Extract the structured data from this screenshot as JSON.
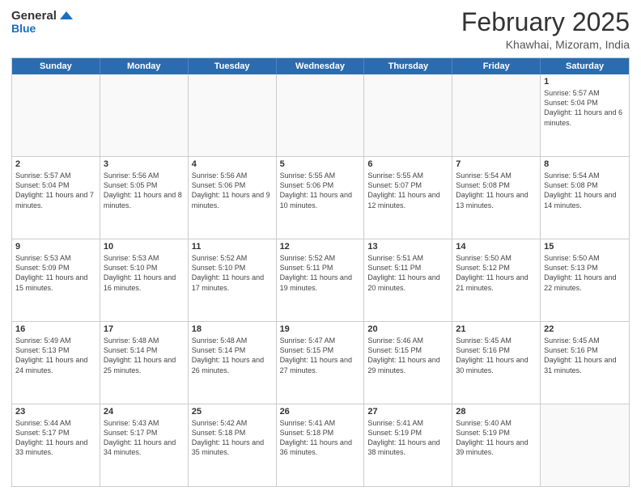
{
  "header": {
    "logo_line1": "General",
    "logo_line2": "Blue",
    "month": "February 2025",
    "location": "Khawhai, Mizoram, India"
  },
  "days_of_week": [
    "Sunday",
    "Monday",
    "Tuesday",
    "Wednesday",
    "Thursday",
    "Friday",
    "Saturday"
  ],
  "weeks": [
    [
      {
        "day": "",
        "info": ""
      },
      {
        "day": "",
        "info": ""
      },
      {
        "day": "",
        "info": ""
      },
      {
        "day": "",
        "info": ""
      },
      {
        "day": "",
        "info": ""
      },
      {
        "day": "",
        "info": ""
      },
      {
        "day": "1",
        "info": "Sunrise: 5:57 AM\nSunset: 5:04 PM\nDaylight: 11 hours and 6 minutes."
      }
    ],
    [
      {
        "day": "2",
        "info": "Sunrise: 5:57 AM\nSunset: 5:04 PM\nDaylight: 11 hours and 7 minutes."
      },
      {
        "day": "3",
        "info": "Sunrise: 5:56 AM\nSunset: 5:05 PM\nDaylight: 11 hours and 8 minutes."
      },
      {
        "day": "4",
        "info": "Sunrise: 5:56 AM\nSunset: 5:06 PM\nDaylight: 11 hours and 9 minutes."
      },
      {
        "day": "5",
        "info": "Sunrise: 5:55 AM\nSunset: 5:06 PM\nDaylight: 11 hours and 10 minutes."
      },
      {
        "day": "6",
        "info": "Sunrise: 5:55 AM\nSunset: 5:07 PM\nDaylight: 11 hours and 12 minutes."
      },
      {
        "day": "7",
        "info": "Sunrise: 5:54 AM\nSunset: 5:08 PM\nDaylight: 11 hours and 13 minutes."
      },
      {
        "day": "8",
        "info": "Sunrise: 5:54 AM\nSunset: 5:08 PM\nDaylight: 11 hours and 14 minutes."
      }
    ],
    [
      {
        "day": "9",
        "info": "Sunrise: 5:53 AM\nSunset: 5:09 PM\nDaylight: 11 hours and 15 minutes."
      },
      {
        "day": "10",
        "info": "Sunrise: 5:53 AM\nSunset: 5:10 PM\nDaylight: 11 hours and 16 minutes."
      },
      {
        "day": "11",
        "info": "Sunrise: 5:52 AM\nSunset: 5:10 PM\nDaylight: 11 hours and 17 minutes."
      },
      {
        "day": "12",
        "info": "Sunrise: 5:52 AM\nSunset: 5:11 PM\nDaylight: 11 hours and 19 minutes."
      },
      {
        "day": "13",
        "info": "Sunrise: 5:51 AM\nSunset: 5:11 PM\nDaylight: 11 hours and 20 minutes."
      },
      {
        "day": "14",
        "info": "Sunrise: 5:50 AM\nSunset: 5:12 PM\nDaylight: 11 hours and 21 minutes."
      },
      {
        "day": "15",
        "info": "Sunrise: 5:50 AM\nSunset: 5:13 PM\nDaylight: 11 hours and 22 minutes."
      }
    ],
    [
      {
        "day": "16",
        "info": "Sunrise: 5:49 AM\nSunset: 5:13 PM\nDaylight: 11 hours and 24 minutes."
      },
      {
        "day": "17",
        "info": "Sunrise: 5:48 AM\nSunset: 5:14 PM\nDaylight: 11 hours and 25 minutes."
      },
      {
        "day": "18",
        "info": "Sunrise: 5:48 AM\nSunset: 5:14 PM\nDaylight: 11 hours and 26 minutes."
      },
      {
        "day": "19",
        "info": "Sunrise: 5:47 AM\nSunset: 5:15 PM\nDaylight: 11 hours and 27 minutes."
      },
      {
        "day": "20",
        "info": "Sunrise: 5:46 AM\nSunset: 5:15 PM\nDaylight: 11 hours and 29 minutes."
      },
      {
        "day": "21",
        "info": "Sunrise: 5:45 AM\nSunset: 5:16 PM\nDaylight: 11 hours and 30 minutes."
      },
      {
        "day": "22",
        "info": "Sunrise: 5:45 AM\nSunset: 5:16 PM\nDaylight: 11 hours and 31 minutes."
      }
    ],
    [
      {
        "day": "23",
        "info": "Sunrise: 5:44 AM\nSunset: 5:17 PM\nDaylight: 11 hours and 33 minutes."
      },
      {
        "day": "24",
        "info": "Sunrise: 5:43 AM\nSunset: 5:17 PM\nDaylight: 11 hours and 34 minutes."
      },
      {
        "day": "25",
        "info": "Sunrise: 5:42 AM\nSunset: 5:18 PM\nDaylight: 11 hours and 35 minutes."
      },
      {
        "day": "26",
        "info": "Sunrise: 5:41 AM\nSunset: 5:18 PM\nDaylight: 11 hours and 36 minutes."
      },
      {
        "day": "27",
        "info": "Sunrise: 5:41 AM\nSunset: 5:19 PM\nDaylight: 11 hours and 38 minutes."
      },
      {
        "day": "28",
        "info": "Sunrise: 5:40 AM\nSunset: 5:19 PM\nDaylight: 11 hours and 39 minutes."
      },
      {
        "day": "",
        "info": ""
      }
    ]
  ]
}
